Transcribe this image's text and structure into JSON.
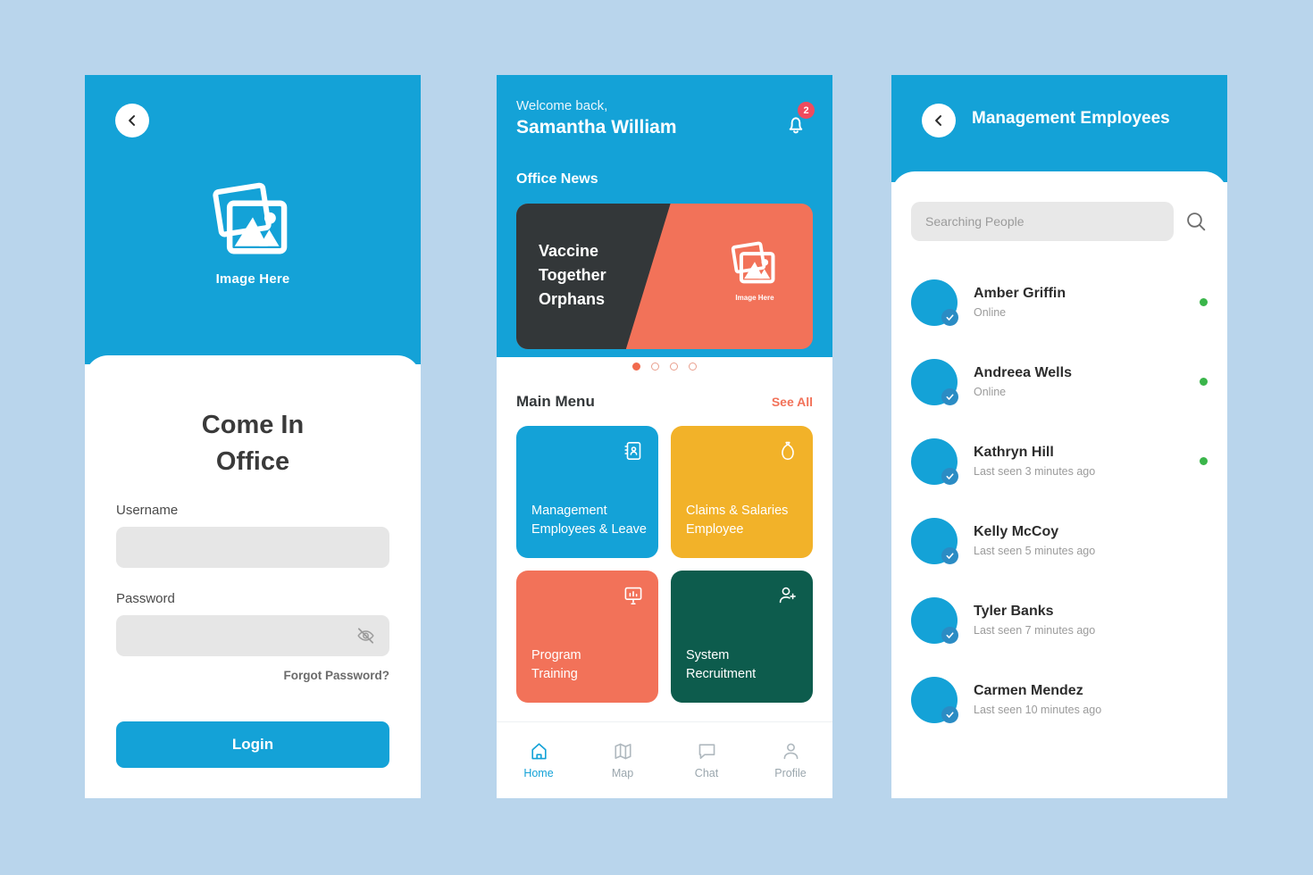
{
  "theme": {
    "background": "#b9d5ec",
    "brand_blue": "#14a2d7",
    "orange": "#f27259",
    "yellow": "#f2b229",
    "green": "#0d5c4d",
    "dark": "#333739",
    "online_green": "#3ab54a",
    "badge_red": "#ef4b5e"
  },
  "login": {
    "back_icon": "chevron-left-icon",
    "image_placeholder": {
      "icon": "image-placeholder-icon",
      "label": "Image Here"
    },
    "title_line1": "Come In",
    "title_line2": "Office",
    "username_label": "Username",
    "username_value": "",
    "username_placeholder": "",
    "password_label": "Password",
    "password_value": "",
    "password_placeholder": "",
    "password_toggle_icon": "eye-off-icon",
    "forgot_label": "Forgot Password?",
    "login_button": "Login"
  },
  "home": {
    "welcome_greeting": "Welcome back,",
    "user_name": "Samantha William",
    "bell_icon": "bell-icon",
    "notification_count": "2",
    "news_section_title": "Office News",
    "news_card": {
      "title": "Vaccine\nTogether\nOrphans",
      "title_line1": "Vaccine",
      "title_line2": "Together",
      "title_line3": "Orphans",
      "image_icon": "image-placeholder-icon",
      "image_label": "Image Here"
    },
    "carousel": {
      "total": 4,
      "active_index": 0
    },
    "menu_title": "Main Menu",
    "see_all_label": "See All",
    "tiles": [
      {
        "label_line1": "Management",
        "label_line2": "Employees & Leave",
        "icon": "contact-book-icon",
        "color": "#14a2d7"
      },
      {
        "label_line1": "Claims & Salaries",
        "label_line2": "Employee",
        "icon": "money-bag-icon",
        "color": "#f2b229"
      },
      {
        "label_line1": "Program",
        "label_line2": "Training",
        "icon": "presentation-board-icon",
        "color": "#f27259"
      },
      {
        "label_line1": "System",
        "label_line2": "Recruitment",
        "icon": "add-person-icon",
        "color": "#0d5c4d"
      }
    ],
    "nav": [
      {
        "label": "Home",
        "icon": "home-icon",
        "active": true
      },
      {
        "label": "Map",
        "icon": "map-icon",
        "active": false
      },
      {
        "label": "Chat",
        "icon": "chat-icon",
        "active": false
      },
      {
        "label": "Profile",
        "icon": "profile-icon",
        "active": false
      }
    ]
  },
  "people": {
    "back_icon": "chevron-left-icon",
    "title": "Management Employees",
    "search_placeholder": "Searching People",
    "search_value": "",
    "search_icon": "search-icon",
    "list": [
      {
        "name": "Amber Griffin",
        "status": "Online",
        "online": true
      },
      {
        "name": "Andreea Wells",
        "status": "Online",
        "online": true
      },
      {
        "name": "Kathryn Hill",
        "status": "Last seen 3 minutes ago",
        "online": true
      },
      {
        "name": "Kelly McCoy",
        "status": "Last seen 5 minutes ago",
        "online": false
      },
      {
        "name": "Tyler Banks",
        "status": "Last seen 7 minutes ago",
        "online": false
      },
      {
        "name": "Carmen Mendez",
        "status": "Last seen 10 minutes ago",
        "online": false
      }
    ]
  }
}
